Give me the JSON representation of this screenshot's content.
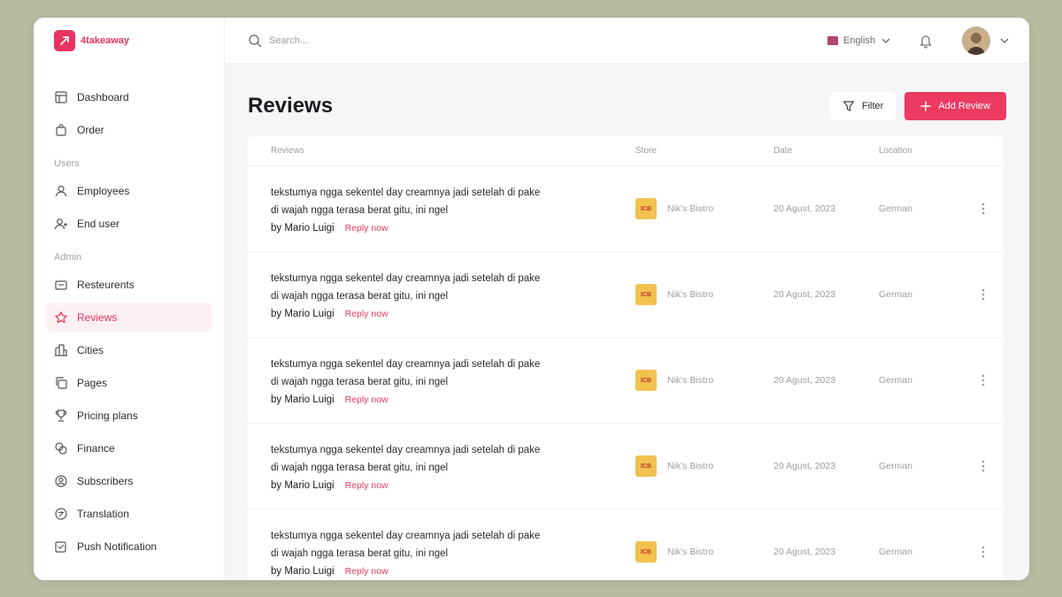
{
  "brand": {
    "name": "4takeaway",
    "color": "#e9325f"
  },
  "sidebar": {
    "main_items": [
      {
        "label": "Dashboard",
        "icon": "dashboard-icon"
      },
      {
        "label": "Order",
        "icon": "bag-icon"
      }
    ],
    "users_label": "Users",
    "users_items": [
      {
        "label": "Employees",
        "icon": "user-icon"
      },
      {
        "label": "End user",
        "icon": "users-icon"
      }
    ],
    "admin_label": "Admin",
    "admin_items": [
      {
        "label": "Resteurents",
        "icon": "store-icon"
      },
      {
        "label": "Reviews",
        "icon": "star-icon",
        "active": true
      },
      {
        "label": "Cities",
        "icon": "city-icon"
      },
      {
        "label": "Pages",
        "icon": "pages-icon"
      },
      {
        "label": "Pricing plans",
        "icon": "trophy-icon"
      },
      {
        "label": "Finance",
        "icon": "finance-icon"
      },
      {
        "label": "Subscribers",
        "icon": "subscribers-icon"
      },
      {
        "label": "Translation",
        "icon": "translation-icon"
      },
      {
        "label": "Push Notification",
        "icon": "notification-icon"
      }
    ]
  },
  "topbar": {
    "search_placeholder": "Search...",
    "language": "English"
  },
  "page": {
    "title": "Reviews",
    "filter_label": "Filter",
    "add_label": "Add Review"
  },
  "table": {
    "columns": [
      "Reviews",
      "Store",
      "Date",
      "Location"
    ],
    "rows": [
      {
        "text": "tekstumya ngga sekentel day creamnya jadi setelah di pake di wajah ngga terasa berat gitu, ini ngel",
        "author": "by Mario Luigi",
        "reply": "Reply now",
        "store": "Nik's Bistro",
        "store_logo": "ICB",
        "date": "20 Agust, 2023",
        "location": "German"
      },
      {
        "text": "tekstumya ngga sekentel day creamnya jadi setelah di pake di wajah ngga terasa berat gitu, ini ngel",
        "author": "by Mario Luigi",
        "reply": "Reply now",
        "store": "Nik's Bistro",
        "store_logo": "ICB",
        "date": "20 Agust, 2023",
        "location": "German"
      },
      {
        "text": "tekstumya ngga sekentel day creamnya jadi setelah di pake di wajah ngga terasa berat gitu, ini ngel",
        "author": "by Mario Luigi",
        "reply": "Reply now",
        "store": "Nik's Bistro",
        "store_logo": "ICB",
        "date": "20 Agust, 2023",
        "location": "German"
      },
      {
        "text": "tekstumya ngga sekentel day creamnya jadi setelah di pake di wajah ngga terasa berat gitu, ini ngel",
        "author": "by Mario Luigi",
        "reply": "Reply now",
        "store": "Nik's Bistro",
        "store_logo": "ICB",
        "date": "20 Agust, 2023",
        "location": "German"
      },
      {
        "text": "tekstumya ngga sekentel day creamnya jadi setelah di pake di wajah ngga terasa berat gitu, ini ngel",
        "author": "by Mario Luigi",
        "reply": "Reply now",
        "store": "Nik's Bistro",
        "store_logo": "ICB",
        "date": "20 Agust, 2023",
        "location": "German"
      }
    ]
  },
  "colors": {
    "accent": "#ec3a62",
    "sidebar_active_bg": "#fdf0f3",
    "store_logo_bg": "#f2c14e"
  }
}
